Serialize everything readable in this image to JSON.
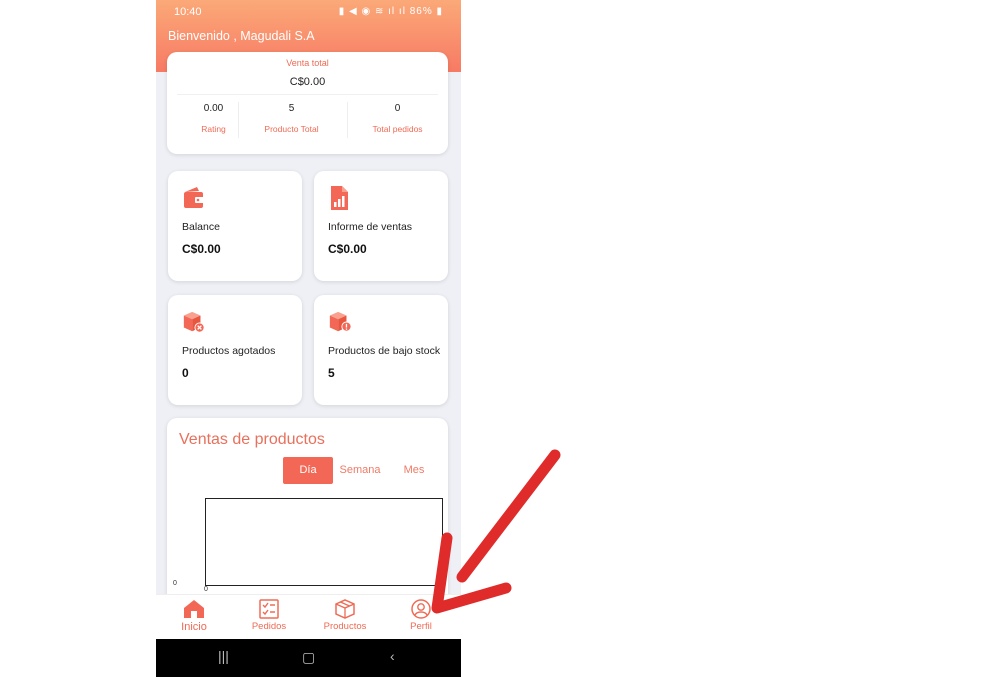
{
  "status": {
    "time": "10:40",
    "battery": "86%"
  },
  "welcome": "Bienvenido , Magudali S.A",
  "summary": {
    "total_label": "Venta total",
    "total_value": "C$0.00",
    "stats": [
      {
        "value": "0.00",
        "label": "Rating"
      },
      {
        "value": "5",
        "label": "Producto Total"
      },
      {
        "value": "0",
        "label": "Total pedidos"
      }
    ]
  },
  "tiles": [
    {
      "label": "Balance",
      "value": "C$0.00",
      "icon": "wallet-icon"
    },
    {
      "label": "Informe de ventas",
      "value": "C$0.00",
      "icon": "sales-report-icon"
    },
    {
      "label": "Productos agotados",
      "value": "0",
      "icon": "box-out-of-stock-icon"
    },
    {
      "label": "Productos de bajo stock",
      "value": "5",
      "icon": "box-low-stock-icon"
    }
  ],
  "chart": {
    "title": "Ventas de productos",
    "periods": [
      {
        "label": "Día",
        "active": true
      },
      {
        "label": "Semana",
        "active": false
      },
      {
        "label": "Mes",
        "active": false
      }
    ],
    "y_axis_zero": "0",
    "x_axis_zero": "0"
  },
  "chart_data": {
    "type": "line",
    "title": "Ventas de productos",
    "series": [],
    "xlabel": "",
    "ylabel": "",
    "tick_labels": {
      "x": [
        "0"
      ],
      "y": [
        "0"
      ]
    }
  },
  "tabs": [
    {
      "label": "Inicio",
      "icon": "home-icon",
      "active": true
    },
    {
      "label": "Pedidos",
      "icon": "orders-checklist-icon",
      "active": false
    },
    {
      "label": "Productos",
      "icon": "product-box-icon",
      "active": false
    },
    {
      "label": "Perfil",
      "icon": "profile-user-icon",
      "active": false
    }
  ],
  "colors": {
    "accent": "#f26755",
    "header_top": "#fba978",
    "header_bottom": "#f77a64",
    "annotation_arrow": "#e02b2b"
  }
}
